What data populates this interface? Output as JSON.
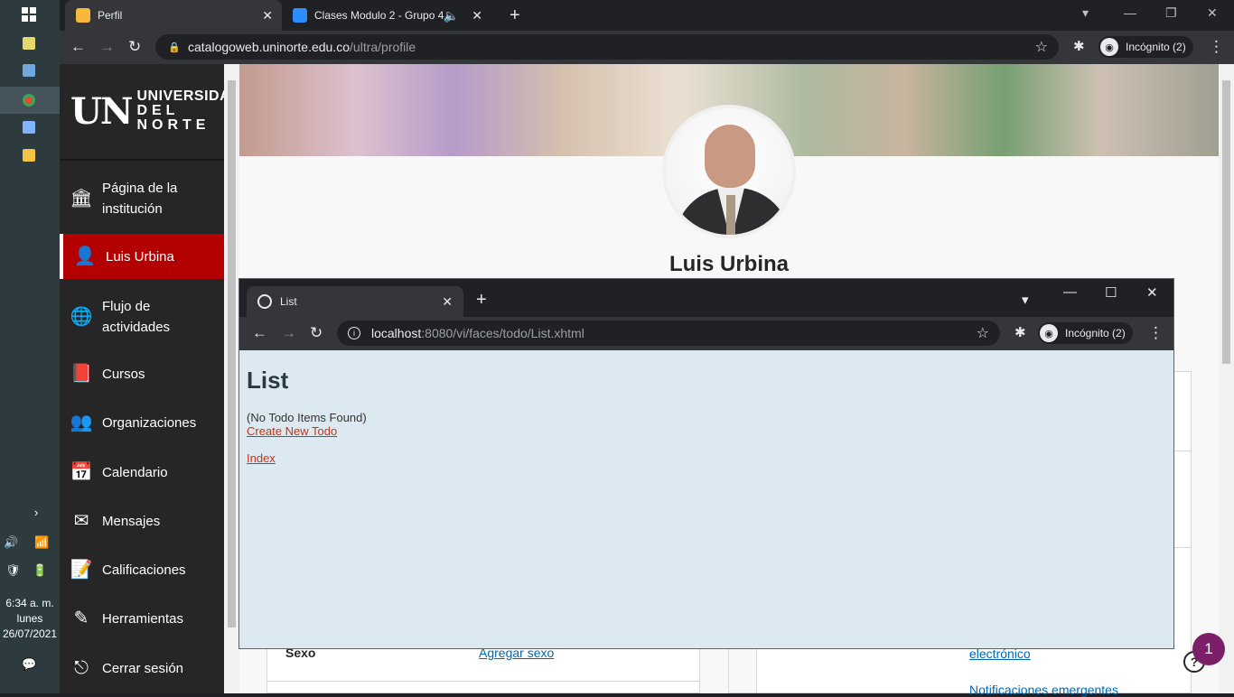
{
  "taskbar": {
    "clock_time": "6:34 a. m.",
    "clock_day": "lunes",
    "clock_date": "26/07/2021"
  },
  "browser": {
    "tabs": [
      {
        "label": "Perfil",
        "active": true
      },
      {
        "label": "Clases Modulo 2 - Grupo 4",
        "active": false
      }
    ],
    "url_host": "catalogoweb.uninorte.edu.co",
    "url_path": "/ultra/profile",
    "incognito_label": "Incógnito (2)"
  },
  "sidebar": {
    "logo_mark": "UN",
    "logo_line1": "UNIVERSIDAD",
    "logo_line2": "DEL NORTE",
    "items": [
      {
        "label": "Página de la institución",
        "icon": "institution-icon"
      },
      {
        "label": "Luis Urbina",
        "icon": "user-icon",
        "active": true
      },
      {
        "label": "Flujo de actividades",
        "icon": "globe-icon"
      },
      {
        "label": "Cursos",
        "icon": "book-icon"
      },
      {
        "label": "Organizaciones",
        "icon": "people-icon"
      },
      {
        "label": "Calendario",
        "icon": "calendar-icon"
      },
      {
        "label": "Mensajes",
        "icon": "mail-icon"
      },
      {
        "label": "Calificaciones",
        "icon": "grades-icon"
      },
      {
        "label": "Herramientas",
        "icon": "tools-icon"
      },
      {
        "label": "Cerrar sesión",
        "icon": "logout-icon"
      }
    ]
  },
  "profile": {
    "name": "Luis Urbina",
    "sex_label": "Sexo",
    "sex_link": "Agregar sexo",
    "email_link": "electrónico",
    "notif_link": "Notificaciones emergentes",
    "notification_count": "1"
  },
  "popup": {
    "tab_title": "List",
    "url_host": "localhost",
    "url_rest": ":8080/vi/faces/todo/List.xhtml",
    "incognito_label": "Incógnito (2)",
    "heading": "List",
    "empty_message": "(No Todo Items Found)",
    "create_link": "Create New Todo",
    "index_link": "Index"
  },
  "colors": {
    "accent": "#b30000",
    "popup_bg": "#dde9f0",
    "link": "#c23616"
  }
}
